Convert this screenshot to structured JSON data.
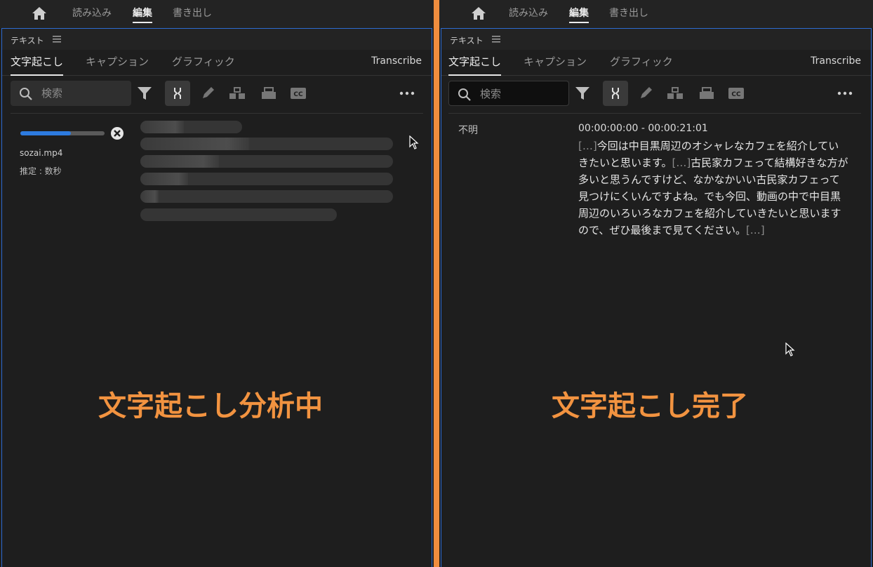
{
  "nav": {
    "items": [
      "読み込み",
      "編集",
      "書き出し"
    ],
    "active": 1
  },
  "panel": {
    "title": "テキスト",
    "tabs": [
      "文字起こし",
      "キャプション",
      "グラフィック"
    ],
    "transcribe_label": "Transcribe",
    "search_placeholder": "検索"
  },
  "left": {
    "progress": 0.6,
    "file_name": "sozai.mp4",
    "eta": "推定 : 数秒",
    "status_label": "文字起こし分析中"
  },
  "right": {
    "speaker": "不明",
    "timecode": "00:00:00:00 - 00:00:21:01",
    "segments": [
      {
        "type": "sep",
        "text": "[…]"
      },
      {
        "type": "text",
        "text": "今回は中目黒周辺のオシャレなカフェを紹介していきたいと思います。"
      },
      {
        "type": "sep",
        "text": "[…]"
      },
      {
        "type": "text",
        "text": "古民家カフェって結構好きな方が多いと思うんですけど、なかなかいい古民家カフェって見つけにくいんですよね。でも今回、動画の中で中目黒周辺のいろいろなカフェを紹介していきたいと思いますので、ぜひ最後まで見てください。"
      },
      {
        "type": "sep",
        "text": "[…]"
      }
    ],
    "status_label": "文字起こし完了"
  },
  "colors": {
    "accent": "#f29340",
    "divider": "#f08d3e",
    "progress": "#2d7be0",
    "panel_border": "#2d6bd1"
  }
}
